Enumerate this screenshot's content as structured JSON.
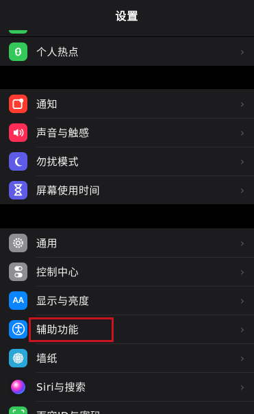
{
  "nav": {
    "title": "设置"
  },
  "groups": [
    {
      "items": [
        {
          "label": "个人热点",
          "icon": "hotspot-icon",
          "color": "#34c759"
        }
      ]
    },
    {
      "items": [
        {
          "label": "通知",
          "icon": "notifications-icon",
          "color": "#ff3b30"
        },
        {
          "label": "声音与触感",
          "icon": "sound-icon",
          "color": "#ff2d55"
        },
        {
          "label": "勿扰模式",
          "icon": "moon-icon",
          "color": "#5e5ce6"
        },
        {
          "label": "屏幕使用时间",
          "icon": "hourglass-icon",
          "color": "#5e5ce6"
        }
      ]
    },
    {
      "items": [
        {
          "label": "通用",
          "icon": "gear-icon",
          "color": "#8e8e93"
        },
        {
          "label": "控制中心",
          "icon": "toggles-icon",
          "color": "#8e8e93"
        },
        {
          "label": "显示与亮度",
          "icon": "display-aa-icon",
          "color": "#0a84ff"
        },
        {
          "label": "辅助功能",
          "icon": "accessibility-icon",
          "color": "#0a84ff"
        },
        {
          "label": "墙纸",
          "icon": "flower-icon",
          "color": "#2aa7d9"
        },
        {
          "label": "Siri与搜索",
          "icon": "siri-icon",
          "color": "#222222"
        },
        {
          "label": "面容ID与密码",
          "icon": "faceid-icon",
          "color": "#34c759"
        }
      ]
    }
  ],
  "chevron": "›"
}
